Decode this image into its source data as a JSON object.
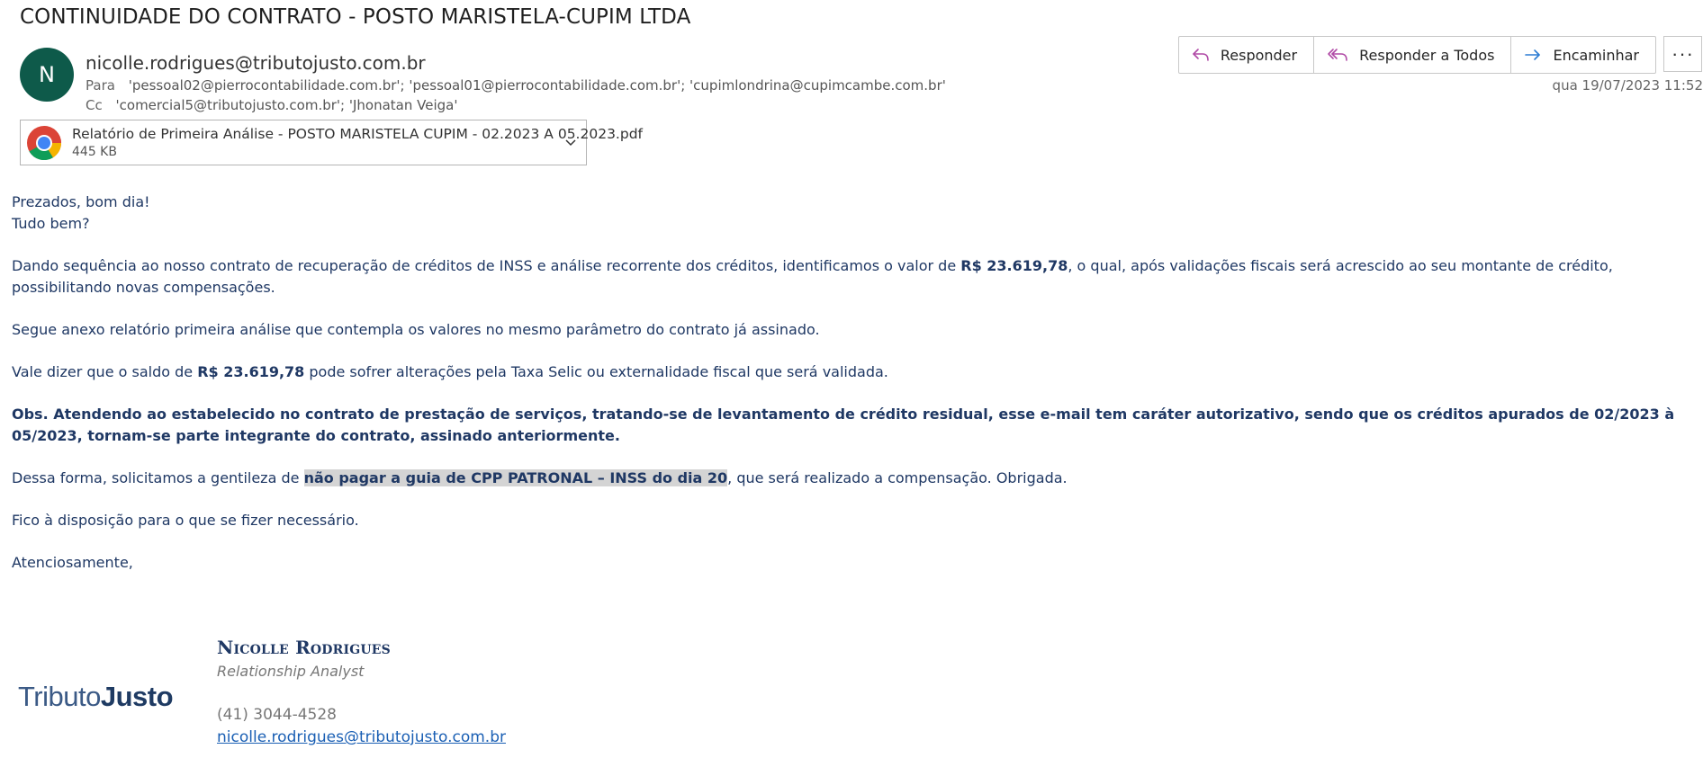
{
  "email": {
    "subject": "CONTINUIDADE DO CONTRATO - POSTO MARISTELA-CUPIM LTDA",
    "avatar_initial": "N",
    "sender": "nicolle.rodrigues@tributojusto.com.br",
    "to_label": "Para",
    "to_value": "'pessoal02@pierrocontabilidade.com.br'; 'pessoal01@pierrocontabilidade.com.br'; 'cupimlondrina@cupimcambe.com.br'",
    "cc_label": "Cc",
    "cc_value": "'comercial5@tributojusto.com.br'; 'Jhonatan Veiga'",
    "date": "qua 19/07/2023 11:52"
  },
  "actions": {
    "reply": "Responder",
    "reply_all": "Responder a Todos",
    "forward": "Encaminhar",
    "more": "···"
  },
  "attachment": {
    "filename": "Relatório de Primeira Análise - POSTO MARISTELA CUPIM - 02.2023 A 05.2023.pdf",
    "size": "445 KB",
    "icon": "chrome-icon"
  },
  "body": {
    "greeting1": "Prezados, bom dia!",
    "greeting2": "Tudo bem?",
    "p1_a": "Dando sequência ao nosso contrato de recuperação de créditos de INSS e análise recorrente dos créditos, identificamos o valor de ",
    "p1_amount": "R$ 23.619,78",
    "p1_b": ", o qual, após validações fiscais será acrescido ao seu montante de crédito, possibilitando novas compensações.",
    "p2": "Segue anexo relatório primeira análise que contempla os valores no mesmo parâmetro do contrato já assinado.",
    "p3_a": "Vale dizer que o saldo de ",
    "p3_amount": "R$ 23.619,78",
    "p3_b": " pode sofrer alterações pela Taxa Selic ou externalidade fiscal que será validada.",
    "p4": "Obs. Atendendo ao estabelecido no contrato de prestação de serviços, tratando-se de levantamento de crédito residual, esse e-mail tem caráter autorizativo, sendo que os créditos apurados de 02/2023 à 05/2023, tornam-se parte integrante do contrato, assinado anteriormente.",
    "p5_a": "Dessa forma, solicitamos a gentileza de ",
    "p5_highlight": "não pagar a guia de CPP PATRONAL – INSS do dia 20",
    "p5_b": ", que será realizado a compensação. Obrigada.",
    "p6": "Fico à disposição para o que se fizer necessário.",
    "closing": "Atenciosamente,"
  },
  "signature": {
    "logo_part1": "Tributo",
    "logo_part2": "Justo",
    "name": "Nicolle Rodrigues",
    "title": "Relationship Analyst",
    "phone": "(41) 3044-4528",
    "email": "nicolle.rodrigues@tributojusto.com.br"
  },
  "colors": {
    "avatar_bg": "#0e5a4a",
    "body_text": "#1f3864",
    "link": "#1a5fb4",
    "highlight": "#d4d4d4",
    "reply_icon": "#b04aa6",
    "forward_icon": "#2b7cd3"
  }
}
